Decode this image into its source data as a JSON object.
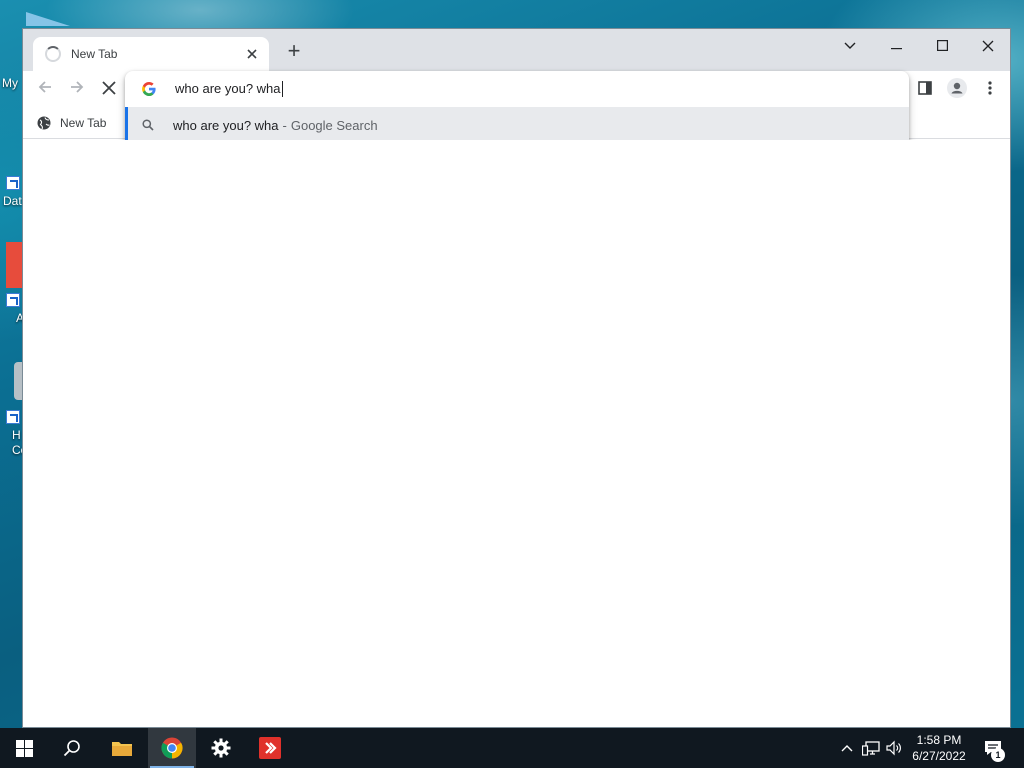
{
  "desktop": {
    "labels": [
      "My",
      "Dat",
      "A",
      "H",
      "Co"
    ]
  },
  "browser": {
    "tab": {
      "title": "New Tab"
    },
    "new_tab_symbol": "+",
    "bookmarks": [
      {
        "label": "New Tab"
      }
    ],
    "omnibox": {
      "query": "who are you? wha",
      "suggestion": {
        "text": "who are you? wha",
        "separator": "-",
        "source": "Google Search"
      }
    }
  },
  "taskbar": {
    "apps": [
      "start",
      "search",
      "file-explorer",
      "chrome",
      "settings",
      "app-red"
    ],
    "active_app": "chrome",
    "clock": {
      "time": "1:58 PM",
      "date": "6/27/2022"
    },
    "notification_count": "1"
  },
  "colors": {
    "accent": "#1a73e8",
    "tabstrip": "#dee1e6",
    "taskbar": "#101820"
  }
}
